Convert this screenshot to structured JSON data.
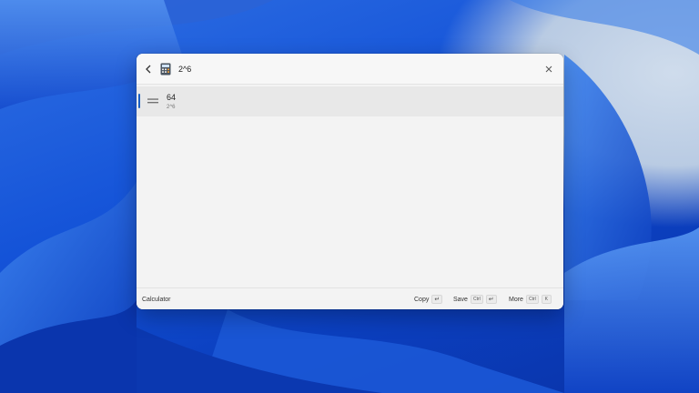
{
  "window": {
    "query": "2^6",
    "back_icon": "chevron-left-icon",
    "app_icon": "calculator-icon",
    "close_icon": "close-icon"
  },
  "result": {
    "value": "64",
    "expression": "2^6",
    "icon": "equals-icon"
  },
  "footer": {
    "app_name": "Calculator",
    "actions": [
      {
        "label": "Copy",
        "keys": [
          "↵"
        ]
      },
      {
        "label": "Save",
        "keys": [
          "Ctrl",
          "↵"
        ]
      },
      {
        "label": "More",
        "keys": [
          "Ctrl",
          "K"
        ]
      }
    ]
  },
  "colors": {
    "accent": "#1a5fc4",
    "wallpaper_blue": "#1453d8",
    "window_bg": "#f3f3f3"
  }
}
